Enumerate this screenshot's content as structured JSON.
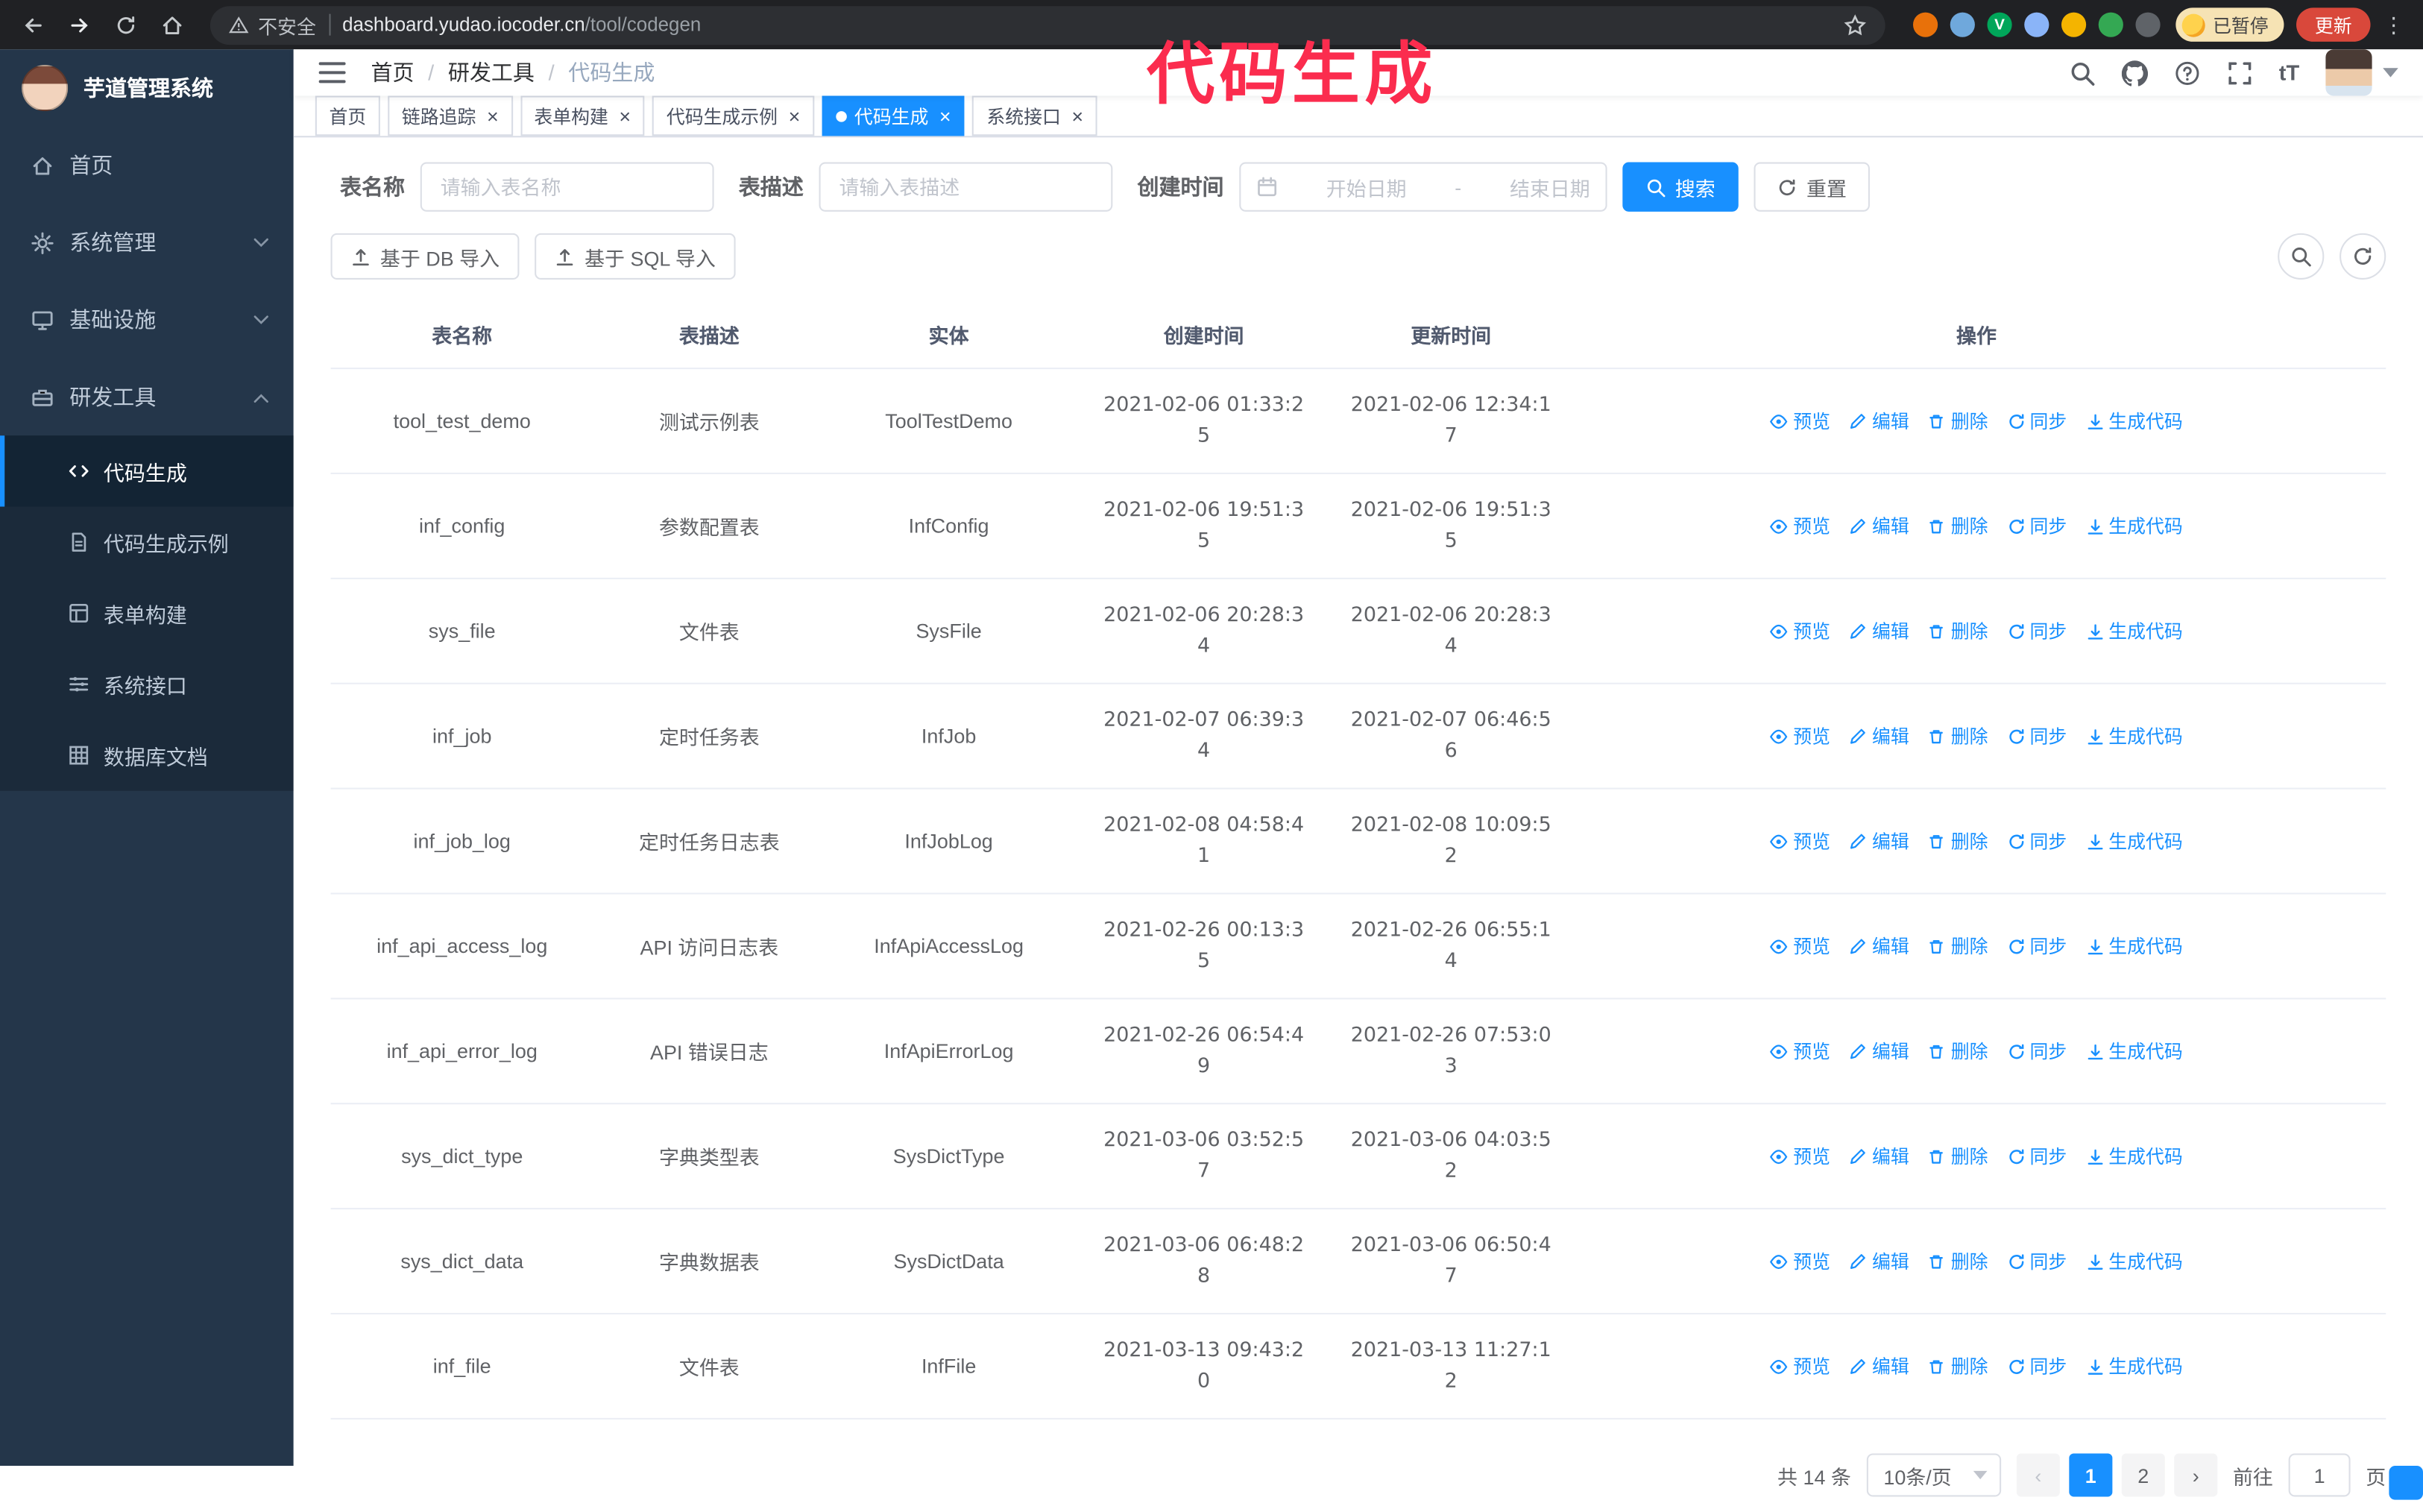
{
  "annotation": {
    "text": "代码生成",
    "color": "#fb2c4e"
  },
  "browser": {
    "security_label": "不安全",
    "url_host": "dashboard.yudao.iocoder.cn",
    "url_path": "/tool/codegen",
    "paused_badge": "已暂停",
    "update_button": "更新",
    "extensions": [
      {
        "name": "extension-icon-orange",
        "color": "#e8710a",
        "glyph": ""
      },
      {
        "name": "extension-icon-blue",
        "color": "#6fa8dc",
        "glyph": ""
      },
      {
        "name": "extension-icon-green-v",
        "color": "#00a65a",
        "glyph": "V"
      },
      {
        "name": "extension-icon-people",
        "color": "#8ab4f8",
        "glyph": ""
      },
      {
        "name": "extension-icon-yellow",
        "color": "#f4b400",
        "glyph": ""
      },
      {
        "name": "extension-icon-leaf",
        "color": "#34a853",
        "glyph": ""
      },
      {
        "name": "extension-icon-puzzle",
        "color": "#5f6368",
        "glyph": ""
      }
    ]
  },
  "sidebar": {
    "app_title": "芋道管理系统",
    "items": [
      {
        "label": "首页",
        "key": "home",
        "icon": "home-icon",
        "expandable": false,
        "expanded": false
      },
      {
        "label": "系统管理",
        "key": "system-management",
        "icon": "gear-icon",
        "expandable": true,
        "expanded": false
      },
      {
        "label": "基础设施",
        "key": "infrastructure",
        "icon": "monitor-icon",
        "expandable": true,
        "expanded": false
      },
      {
        "label": "研发工具",
        "key": "dev-tools",
        "icon": "tools-icon",
        "expandable": true,
        "expanded": true
      }
    ],
    "subitems": [
      {
        "label": "代码生成",
        "key": "codegen",
        "icon": "code-icon",
        "active": true
      },
      {
        "label": "代码生成示例",
        "key": "codegen-example",
        "icon": "doc-icon",
        "active": false
      },
      {
        "label": "表单构建",
        "key": "form-build",
        "icon": "form-icon",
        "active": false
      },
      {
        "label": "系统接口",
        "key": "system-api",
        "icon": "api-icon",
        "active": false
      },
      {
        "label": "数据库文档",
        "key": "db-doc",
        "icon": "db-icon",
        "active": false
      }
    ]
  },
  "header": {
    "breadcrumb": [
      "首页",
      "研发工具",
      "代码生成"
    ]
  },
  "tabs": [
    {
      "label": "首页",
      "key": "home",
      "closable": false,
      "active": false
    },
    {
      "label": "链路追踪",
      "key": "tracing",
      "closable": true,
      "active": false
    },
    {
      "label": "表单构建",
      "key": "form-build",
      "closable": true,
      "active": false
    },
    {
      "label": "代码生成示例",
      "key": "codegen-example",
      "closable": true,
      "active": false
    },
    {
      "label": "代码生成",
      "key": "codegen",
      "closable": true,
      "active": true
    },
    {
      "label": "系统接口",
      "key": "system-api",
      "closable": true,
      "active": false
    }
  ],
  "filters": {
    "table_name_label": "表名称",
    "table_name_placeholder": "请输入表名称",
    "table_desc_label": "表描述",
    "table_desc_placeholder": "请输入表描述",
    "create_time_label": "创建时间",
    "date_start_placeholder": "开始日期",
    "date_separator": "-",
    "date_end_placeholder": "结束日期",
    "search_button": "搜索",
    "reset_button": "重置"
  },
  "toolbar": {
    "import_db_button": "基于 DB 导入",
    "import_sql_button": "基于 SQL 导入"
  },
  "table": {
    "columns": [
      "表名称",
      "表描述",
      "实体",
      "创建时间",
      "更新时间",
      "操作"
    ],
    "actions": [
      {
        "label": "预览",
        "key": "preview",
        "icon": "eye-icon"
      },
      {
        "label": "编辑",
        "key": "edit",
        "icon": "edit-icon"
      },
      {
        "label": "删除",
        "key": "delete",
        "icon": "delete-icon"
      },
      {
        "label": "同步",
        "key": "sync",
        "icon": "sync-icon"
      },
      {
        "label": "生成代码",
        "key": "generate-code",
        "icon": "download-icon"
      }
    ],
    "rows": [
      {
        "name": "tool_test_demo",
        "desc": "测试示例表",
        "entity": "ToolTestDemo",
        "created": "2021-02-06 01:33:25",
        "updated": "2021-02-06 12:34:17"
      },
      {
        "name": "inf_config",
        "desc": "参数配置表",
        "entity": "InfConfig",
        "created": "2021-02-06 19:51:35",
        "updated": "2021-02-06 19:51:35"
      },
      {
        "name": "sys_file",
        "desc": "文件表",
        "entity": "SysFile",
        "created": "2021-02-06 20:28:34",
        "updated": "2021-02-06 20:28:34"
      },
      {
        "name": "inf_job",
        "desc": "定时任务表",
        "entity": "InfJob",
        "created": "2021-02-07 06:39:34",
        "updated": "2021-02-07 06:46:56"
      },
      {
        "name": "inf_job_log",
        "desc": "定时任务日志表",
        "entity": "InfJobLog",
        "created": "2021-02-08 04:58:41",
        "updated": "2021-02-08 10:09:52"
      },
      {
        "name": "inf_api_access_log",
        "desc": "API 访问日志表",
        "entity": "InfApiAccessLog",
        "created": "2021-02-26 00:13:35",
        "updated": "2021-02-26 06:55:14"
      },
      {
        "name": "inf_api_error_log",
        "desc": "API 错误日志",
        "entity": "InfApiErrorLog",
        "created": "2021-02-26 06:54:49",
        "updated": "2021-02-26 07:53:03"
      },
      {
        "name": "sys_dict_type",
        "desc": "字典类型表",
        "entity": "SysDictType",
        "created": "2021-03-06 03:52:57",
        "updated": "2021-03-06 04:03:52"
      },
      {
        "name": "sys_dict_data",
        "desc": "字典数据表",
        "entity": "SysDictData",
        "created": "2021-03-06 06:48:28",
        "updated": "2021-03-06 06:50:47"
      },
      {
        "name": "inf_file",
        "desc": "文件表",
        "entity": "InfFile",
        "created": "2021-03-13 09:43:20",
        "updated": "2021-03-13 11:27:12"
      }
    ]
  },
  "pagination": {
    "total": "共 14 条",
    "page_size": "10条/页",
    "pages": [
      "1",
      "2"
    ],
    "active_page": "1",
    "prev_glyph": "‹",
    "next_glyph": "›",
    "goto_label": "前往",
    "goto_value": "1",
    "goto_suffix": "页"
  },
  "colors": {
    "accent": "#1890ff",
    "annotation": "#fb2c4e",
    "sidebar_bg": "#24364a",
    "submenu_bg": "#1b2a3a",
    "chrome_bg": "#202124",
    "update_button_bg": "#d9483b"
  }
}
